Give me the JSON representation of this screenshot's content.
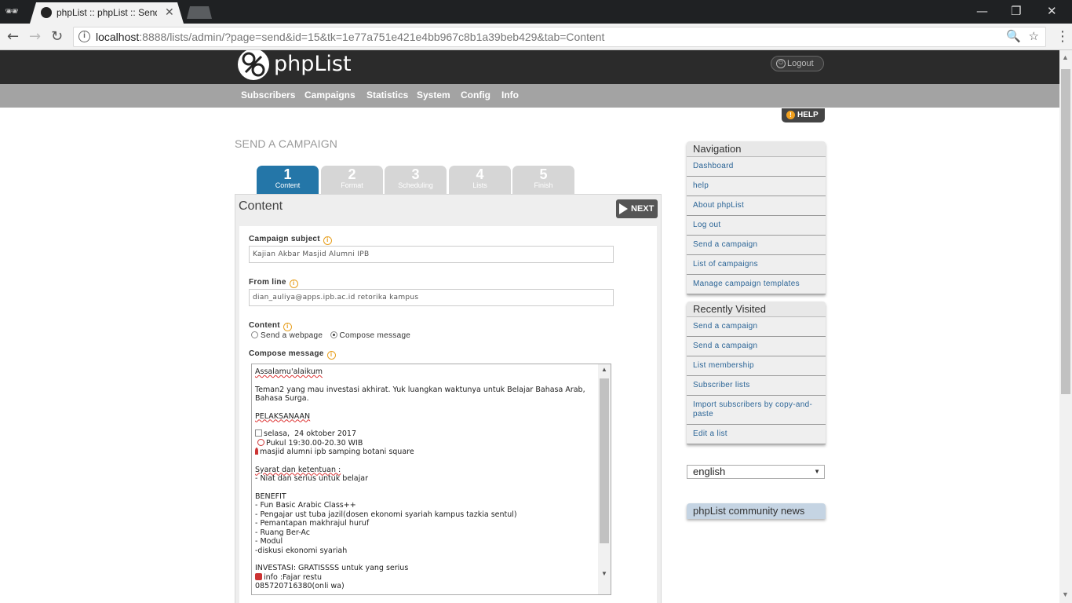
{
  "browser": {
    "tab_title": "phpList :: phpList :: Send",
    "tab_close": "✕",
    "url_host": "localhost",
    "url_rest": ":8888/lists/admin/?page=send&id=15&tk=1e77a751e421e4bb967c8b1a39beb429&tab=Content",
    "window_minimize": "—",
    "window_restore": "❐",
    "window_close": "✕"
  },
  "header": {
    "logo_text": "phpList",
    "logout_label": "Logout"
  },
  "menu": {
    "items": [
      "Subscribers",
      "Campaigns",
      "Statistics",
      "System",
      "Config",
      "Info"
    ]
  },
  "help_label": "HELP",
  "page_title": "SEND A CAMPAIGN",
  "steps": [
    {
      "num": "1",
      "label": "Content",
      "active": true
    },
    {
      "num": "2",
      "label": "Format",
      "active": false
    },
    {
      "num": "3",
      "label": "Scheduling",
      "active": false
    },
    {
      "num": "4",
      "label": "Lists",
      "active": false
    },
    {
      "num": "5",
      "label": "Finish",
      "active": false
    }
  ],
  "content_panel": {
    "heading": "Content",
    "next_label": "NEXT"
  },
  "form": {
    "subject_label": "Campaign subject",
    "subject_value": "Kajian Akbar Masjid Alumni IPB",
    "from_label": "From line",
    "from_value": "dian_auliya@apps.ipb.ac.id retorika kampus",
    "content_label": "Content",
    "radio_webpage": "Send a webpage",
    "radio_compose": "Compose message",
    "radio_selected": "compose",
    "compose_label": "Compose message"
  },
  "message": {
    "greeting": "Assalamu'alaikum",
    "intro": "Teman2 yang mau investasi akhirat. Yuk luangkan waktunya untuk Belajar Bahasa Arab, Bahasa Surga.",
    "pelaksanaan": "PELAKSANAAN",
    "date": "selasa,  24 oktober 2017",
    "time": "Pukul 19:30.00-20.30 WIB",
    "place": "masjid alumni ipb samping botani square",
    "syarat_title": "Syarat dan ketentuan :",
    "syarat_1": "- Niat dan serius untuk belajar",
    "benefit_title": "BENEFIT",
    "benefit_1": "- Fun Basic Arabic Class++",
    "benefit_2": "- Pengajar ust tuba jazil(dosen ekonomi syariah kampus tazkia sentul)",
    "benefit_3": "- Pemantapan makhrajul huruf",
    "benefit_4": "- Ruang Ber-Ac",
    "benefit_5": "- Modul",
    "benefit_6": "-diskusi ekonomi syariah",
    "investasi": "INVESTASI: GRATISSSS untuk yang serius",
    "info": "info :Fajar restu",
    "phone": "085720716380(onli wa)"
  },
  "sidebar": {
    "navigation_title": "Navigation",
    "navigation_items": [
      "Dashboard",
      "help",
      "About phpList",
      "Log out",
      "Send a campaign",
      "List of campaigns",
      "Manage campaign templates"
    ],
    "recent_title": "Recently Visited",
    "recent_items": [
      "Send a campaign",
      "Send a campaign",
      "List membership",
      "Subscriber lists",
      "Import subscribers by copy-and-paste",
      "Edit a list"
    ],
    "language": "english",
    "news_title": "phpList community news"
  },
  "colors": {
    "header_dark": "#2b2b2b",
    "menubar": "#a3a3a3",
    "step_active": "#2476a8",
    "step_inactive": "#d6d6d6",
    "link": "#2a6496",
    "info_orange": "#e8a020"
  }
}
